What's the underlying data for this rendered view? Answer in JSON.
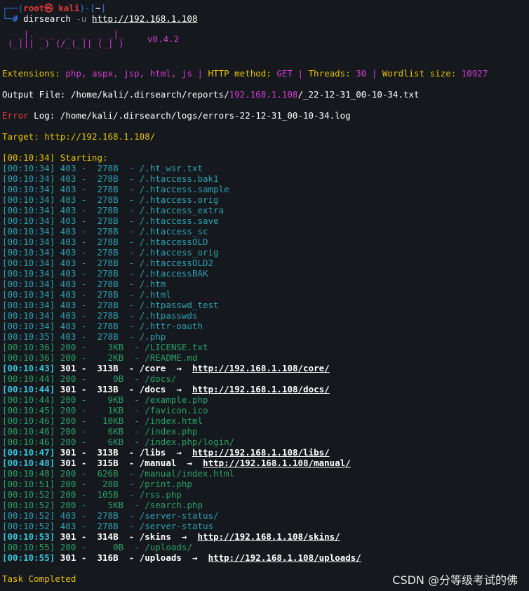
{
  "prompt": {
    "line1_prefix": "┌──(",
    "user": "root",
    "skull": "㉿",
    "host": "kali",
    "line1_mid": ")-[",
    "dir": "~",
    "line1_end": "]",
    "line2_prefix": "└─",
    "hash": "# ",
    "command": "dirsearch",
    "flag": " -u ",
    "url": "http://192.168.1.108"
  },
  "banner": {
    "art_line1": "  _|. _ _  _  _  _ _|_",
    "art_line2": "(_||| _) (/_(_|| (_| )",
    "version": "v0.4.2"
  },
  "config": {
    "ext_label": "Extensions: ",
    "ext_value": "php, aspx, jsp, html, js",
    "sep": " | ",
    "method_label": "HTTP method: ",
    "method_value": "GET",
    "threads_label": "Threads: ",
    "threads_value": "30",
    "wordlist_label": "Wordlist size: ",
    "wordlist_value": "10927"
  },
  "output_file": {
    "label": "Output File: ",
    "path_prefix": "/home/kali/.dirsearch/reports/",
    "host": "192.168.1.108",
    "path_suffix": "/_22-12-31_00-10-34.txt"
  },
  "error_log": {
    "label": "Error",
    "label2": " Log: ",
    "path": "/home/kali/.dirsearch/logs/errors-22-12-31_00-10-34.log"
  },
  "target": {
    "label": "Target: ",
    "url": "http://192.168.1.108/"
  },
  "starting": "[00:10:34] Starting:",
  "results": [
    {
      "time": "[00:10:34]",
      "status": "403",
      "size": "  278B",
      "path": "/.ht_wsr.txt",
      "redirect": ""
    },
    {
      "time": "[00:10:34]",
      "status": "403",
      "size": "  278B",
      "path": "/.htaccess.bak1",
      "redirect": ""
    },
    {
      "time": "[00:10:34]",
      "status": "403",
      "size": "  278B",
      "path": "/.htaccess.sample",
      "redirect": ""
    },
    {
      "time": "[00:10:34]",
      "status": "403",
      "size": "  278B",
      "path": "/.htaccess.orig",
      "redirect": ""
    },
    {
      "time": "[00:10:34]",
      "status": "403",
      "size": "  278B",
      "path": "/.htaccess_extra",
      "redirect": ""
    },
    {
      "time": "[00:10:34]",
      "status": "403",
      "size": "  278B",
      "path": "/.htaccess.save",
      "redirect": ""
    },
    {
      "time": "[00:10:34]",
      "status": "403",
      "size": "  278B",
      "path": "/.htaccess_sc",
      "redirect": ""
    },
    {
      "time": "[00:10:34]",
      "status": "403",
      "size": "  278B",
      "path": "/.htaccessOLD",
      "redirect": ""
    },
    {
      "time": "[00:10:34]",
      "status": "403",
      "size": "  278B",
      "path": "/.htaccess_orig",
      "redirect": ""
    },
    {
      "time": "[00:10:34]",
      "status": "403",
      "size": "  278B",
      "path": "/.htaccessOLD2",
      "redirect": ""
    },
    {
      "time": "[00:10:34]",
      "status": "403",
      "size": "  278B",
      "path": "/.htaccessBAK",
      "redirect": ""
    },
    {
      "time": "[00:10:34]",
      "status": "403",
      "size": "  278B",
      "path": "/.htm",
      "redirect": ""
    },
    {
      "time": "[00:10:34]",
      "status": "403",
      "size": "  278B",
      "path": "/.html",
      "redirect": ""
    },
    {
      "time": "[00:10:34]",
      "status": "403",
      "size": "  278B",
      "path": "/.htpasswd_test",
      "redirect": ""
    },
    {
      "time": "[00:10:34]",
      "status": "403",
      "size": "  278B",
      "path": "/.htpasswds",
      "redirect": ""
    },
    {
      "time": "[00:10:34]",
      "status": "403",
      "size": "  278B",
      "path": "/.httr-oauth",
      "redirect": ""
    },
    {
      "time": "[00:10:35]",
      "status": "403",
      "size": "  278B",
      "path": "/.php",
      "redirect": ""
    },
    {
      "time": "[00:10:36]",
      "status": "200",
      "size": "    3KB",
      "path": "/LICENSE.txt",
      "redirect": ""
    },
    {
      "time": "[00:10:36]",
      "status": "200",
      "size": "    2KB",
      "path": "/README.md",
      "redirect": ""
    },
    {
      "time": "[00:10:43]",
      "status": "301",
      "size": "  313B",
      "path": "/core",
      "redirect": "http://192.168.1.108/core/"
    },
    {
      "time": "[00:10:44]",
      "status": "200",
      "size": "     0B",
      "path": "/docs/",
      "redirect": ""
    },
    {
      "time": "[00:10:44]",
      "status": "301",
      "size": "  313B",
      "path": "/docs",
      "redirect": "http://192.168.1.108/docs/"
    },
    {
      "time": "[00:10:44]",
      "status": "200",
      "size": "    9KB",
      "path": "/example.php",
      "redirect": ""
    },
    {
      "time": "[00:10:45]",
      "status": "200",
      "size": "    1KB",
      "path": "/favicon.ico",
      "redirect": ""
    },
    {
      "time": "[00:10:46]",
      "status": "200",
      "size": "   10KB",
      "path": "/index.html",
      "redirect": ""
    },
    {
      "time": "[00:10:46]",
      "status": "200",
      "size": "    6KB",
      "path": "/index.php",
      "redirect": ""
    },
    {
      "time": "[00:10:46]",
      "status": "200",
      "size": "    6KB",
      "path": "/index.php/login/",
      "redirect": ""
    },
    {
      "time": "[00:10:47]",
      "status": "301",
      "size": "  313B",
      "path": "/libs",
      "redirect": "http://192.168.1.108/libs/"
    },
    {
      "time": "[00:10:48]",
      "status": "301",
      "size": "  315B",
      "path": "/manual",
      "redirect": "http://192.168.1.108/manual/"
    },
    {
      "time": "[00:10:48]",
      "status": "200",
      "size": "  626B",
      "path": "/manual/index.html",
      "redirect": ""
    },
    {
      "time": "[00:10:51]",
      "status": "200",
      "size": "   28B",
      "path": "/print.php",
      "redirect": ""
    },
    {
      "time": "[00:10:52]",
      "status": "200",
      "size": "  105B",
      "path": "/rss.php",
      "redirect": ""
    },
    {
      "time": "[00:10:52]",
      "status": "200",
      "size": "    5KB",
      "path": "/search.php",
      "redirect": ""
    },
    {
      "time": "[00:10:52]",
      "status": "403",
      "size": "  278B",
      "path": "/server-status/",
      "redirect": ""
    },
    {
      "time": "[00:10:52]",
      "status": "403",
      "size": "  278B",
      "path": "/server-status",
      "redirect": ""
    },
    {
      "time": "[00:10:53]",
      "status": "301",
      "size": "  314B",
      "path": "/skins",
      "redirect": "http://192.168.1.108/skins/"
    },
    {
      "time": "[00:10:55]",
      "status": "200",
      "size": "     0B",
      "path": "/uploads/",
      "redirect": ""
    },
    {
      "time": "[00:10:55]",
      "status": "301",
      "size": "  316B",
      "path": "/uploads",
      "redirect": "http://192.168.1.108/uploads/"
    }
  ],
  "arrow": "→",
  "task_completed": "Task Completed",
  "watermark": "CSDN @分等级考试的佛",
  "colors": {
    "status_403": "#2aa1b3",
    "status_200": "#26a269",
    "status_301": "#ffffff",
    "accent_magenta": "#d33dd6",
    "accent_yellow": "#e5c100"
  }
}
